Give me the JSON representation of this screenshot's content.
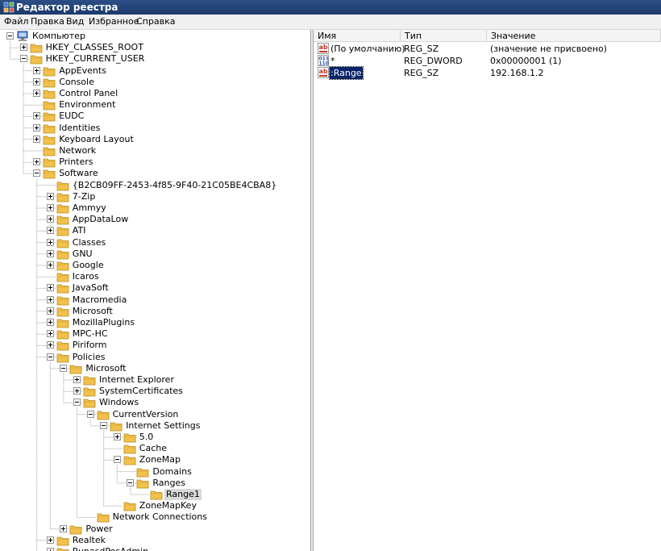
{
  "window": {
    "title": "Редактор реестра"
  },
  "menu": [
    "Файл",
    "Правка",
    "Вид",
    "Избранное",
    "Справка"
  ],
  "values_pane": {
    "columns": {
      "name": "Имя",
      "type": "Тип",
      "value": "Значение"
    },
    "rows": [
      {
        "icon": "string-value-icon",
        "name": "(По умолчанию)",
        "type": "REG_SZ",
        "value": "(значение не присвоено)"
      },
      {
        "icon": "dword-value-icon",
        "name": "*",
        "type": "REG_DWORD",
        "value": "0x00000001 (1)"
      },
      {
        "icon": "string-value-icon",
        "name": ":Range",
        "type": "REG_SZ",
        "value": "192.168.1.2",
        "selected": true
      }
    ]
  },
  "tree": [
    {
      "label": "Компьютер",
      "level": 0,
      "toggle": "minus",
      "icon": "computer"
    },
    {
      "label": "HKEY_CLASSES_ROOT",
      "level": 1,
      "toggle": "plus"
    },
    {
      "label": "HKEY_CURRENT_USER",
      "level": 1,
      "toggle": "minus"
    },
    {
      "label": "AppEvents",
      "level": 2,
      "toggle": "plus"
    },
    {
      "label": "Console",
      "level": 2,
      "toggle": "plus"
    },
    {
      "label": "Control Panel",
      "level": 2,
      "toggle": "plus"
    },
    {
      "label": "Environment",
      "level": 2,
      "toggle": "none"
    },
    {
      "label": "EUDC",
      "level": 2,
      "toggle": "plus"
    },
    {
      "label": "Identities",
      "level": 2,
      "toggle": "plus"
    },
    {
      "label": "Keyboard Layout",
      "level": 2,
      "toggle": "plus"
    },
    {
      "label": "Network",
      "level": 2,
      "toggle": "none"
    },
    {
      "label": "Printers",
      "level": 2,
      "toggle": "plus"
    },
    {
      "label": "Software",
      "level": 2,
      "toggle": "minus"
    },
    {
      "label": "{B2CB09FF-2453-4f85-9F40-21C05BE4CBA8}",
      "level": 3,
      "toggle": "none"
    },
    {
      "label": "7-Zip",
      "level": 3,
      "toggle": "plus"
    },
    {
      "label": "Ammyy",
      "level": 3,
      "toggle": "plus"
    },
    {
      "label": "AppDataLow",
      "level": 3,
      "toggle": "plus"
    },
    {
      "label": "ATI",
      "level": 3,
      "toggle": "plus"
    },
    {
      "label": "Classes",
      "level": 3,
      "toggle": "plus"
    },
    {
      "label": "GNU",
      "level": 3,
      "toggle": "plus"
    },
    {
      "label": "Google",
      "level": 3,
      "toggle": "plus"
    },
    {
      "label": "Icaros",
      "level": 3,
      "toggle": "none"
    },
    {
      "label": "JavaSoft",
      "level": 3,
      "toggle": "plus"
    },
    {
      "label": "Macromedia",
      "level": 3,
      "toggle": "plus"
    },
    {
      "label": "Microsoft",
      "level": 3,
      "toggle": "plus"
    },
    {
      "label": "MozillaPlugins",
      "level": 3,
      "toggle": "plus"
    },
    {
      "label": "MPC-HC",
      "level": 3,
      "toggle": "plus"
    },
    {
      "label": "Piriform",
      "level": 3,
      "toggle": "plus"
    },
    {
      "label": "Policies",
      "level": 3,
      "toggle": "minus"
    },
    {
      "label": "Microsoft",
      "level": 4,
      "toggle": "minus"
    },
    {
      "label": "Internet Explorer",
      "level": 5,
      "toggle": "plus"
    },
    {
      "label": "SystemCertificates",
      "level": 5,
      "toggle": "plus"
    },
    {
      "label": "Windows",
      "level": 5,
      "toggle": "minus"
    },
    {
      "label": "CurrentVersion",
      "level": 6,
      "toggle": "minus"
    },
    {
      "label": "Internet Settings",
      "level": 7,
      "toggle": "minus"
    },
    {
      "label": "5.0",
      "level": 8,
      "toggle": "plus"
    },
    {
      "label": "Cache",
      "level": 8,
      "toggle": "none"
    },
    {
      "label": "ZoneMap",
      "level": 8,
      "toggle": "minus"
    },
    {
      "label": "Domains",
      "level": 9,
      "toggle": "none"
    },
    {
      "label": "Ranges",
      "level": 9,
      "toggle": "minus"
    },
    {
      "label": "Range1",
      "level": 10,
      "toggle": "none",
      "highlight": true
    },
    {
      "label": "ZoneMapKey",
      "level": 8,
      "toggle": "none"
    },
    {
      "label": "Network Connections",
      "level": 6,
      "toggle": "none"
    },
    {
      "label": "Power",
      "level": 4,
      "toggle": "plus"
    },
    {
      "label": "Realtek",
      "level": 3,
      "toggle": "plus"
    },
    {
      "label": "RunasdPosAdmin",
      "level": 3,
      "toggle": "plus"
    }
  ]
}
